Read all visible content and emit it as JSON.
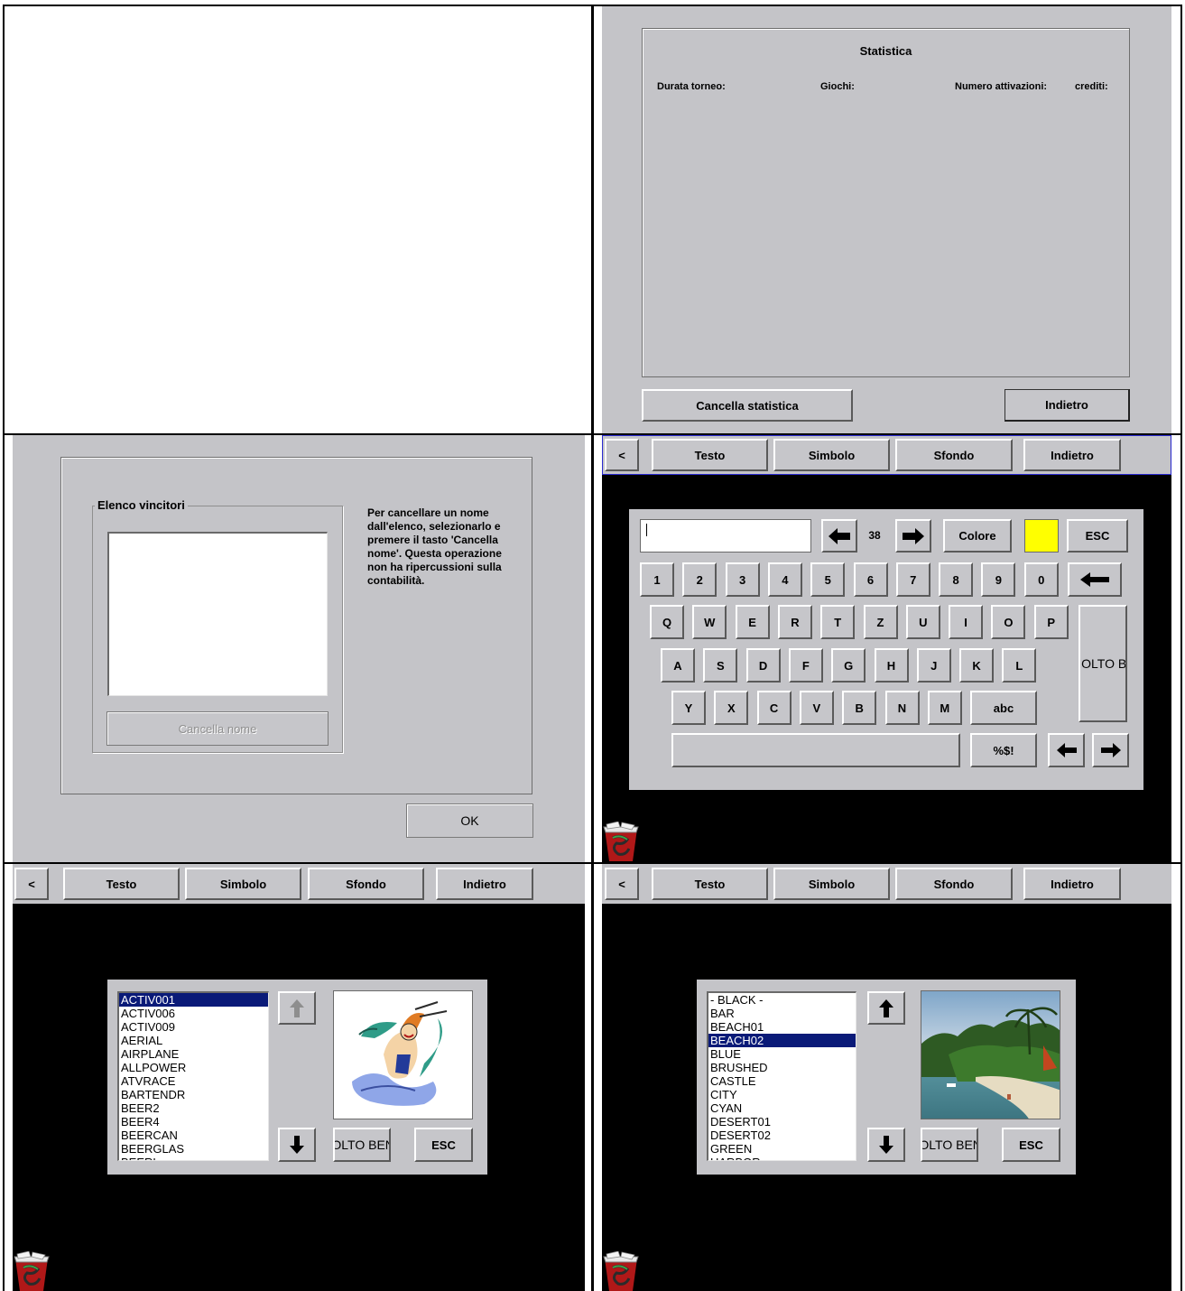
{
  "statistics": {
    "title": "Statistica",
    "col_duration": "Durata torneo:",
    "col_games": "Giochi:",
    "col_activations": "Numero attivazioni:",
    "col_credits": "crediti:",
    "clear_button": "Cancella statistica",
    "back_button": "Indietro"
  },
  "winners": {
    "group_label": "Elenco vincitori",
    "delete_button": "Cancella nome",
    "help_text": "Per cancellare un nome dall'elenco, selezionarlo e premere il tasto 'Cancella nome'. Questa operazione non ha ripercussioni sulla contabilità.",
    "ok_button": "OK"
  },
  "toolbar": {
    "prev": "<",
    "text": "Testo",
    "symbol": "Simbolo",
    "background": "Sfondo",
    "back": "Indietro"
  },
  "keyboard": {
    "input_value": "",
    "size_value": "38",
    "color_button": "Colore",
    "color_swatch": "#ffff00",
    "esc": "ESC",
    "enter_label": "MOLTO BENE",
    "row_numbers": [
      "1",
      "2",
      "3",
      "4",
      "5",
      "6",
      "7",
      "8",
      "9",
      "0"
    ],
    "row_q": [
      "Q",
      "W",
      "E",
      "R",
      "T",
      "Z",
      "U",
      "I",
      "O",
      "P"
    ],
    "row_a": [
      "A",
      "S",
      "D",
      "F",
      "G",
      "H",
      "J",
      "K",
      "L"
    ],
    "row_y": [
      "Y",
      "X",
      "C",
      "V",
      "B",
      "N",
      "M"
    ],
    "abc": "abc",
    "symbols": "%$!"
  },
  "symbol_picker": {
    "items": [
      "ACTIV001",
      "ACTIV006",
      "ACTIV009",
      "AERIAL",
      "AIRPLANE",
      "ALLPOWER",
      "ATVRACE",
      "BARTENDR",
      "BEER2",
      "BEER4",
      "BEERCAN",
      "BEERGLAS",
      "BEERL"
    ],
    "selected": "ACTIV001",
    "ok_button": "MOLTO BENE",
    "esc_button": "ESC"
  },
  "background_picker": {
    "items": [
      "- BLACK -",
      "BAR",
      "BEACH01",
      "BEACH02",
      "BLUE",
      "BRUSHED",
      "CASTLE",
      "CITY",
      "CYAN",
      "DESERT01",
      "DESERT02",
      "GREEN",
      "HARBOR"
    ],
    "selected": "BEACH02",
    "ok_button": "MOLTO BENE",
    "esc_button": "ESC"
  },
  "icons": {
    "trash": "trash-icon",
    "arrow_left": "arrow-left-icon",
    "arrow_right": "arrow-right-icon",
    "arrow_up": "arrow-up-icon",
    "arrow_down": "arrow-down-icon",
    "backspace": "backspace-icon"
  }
}
